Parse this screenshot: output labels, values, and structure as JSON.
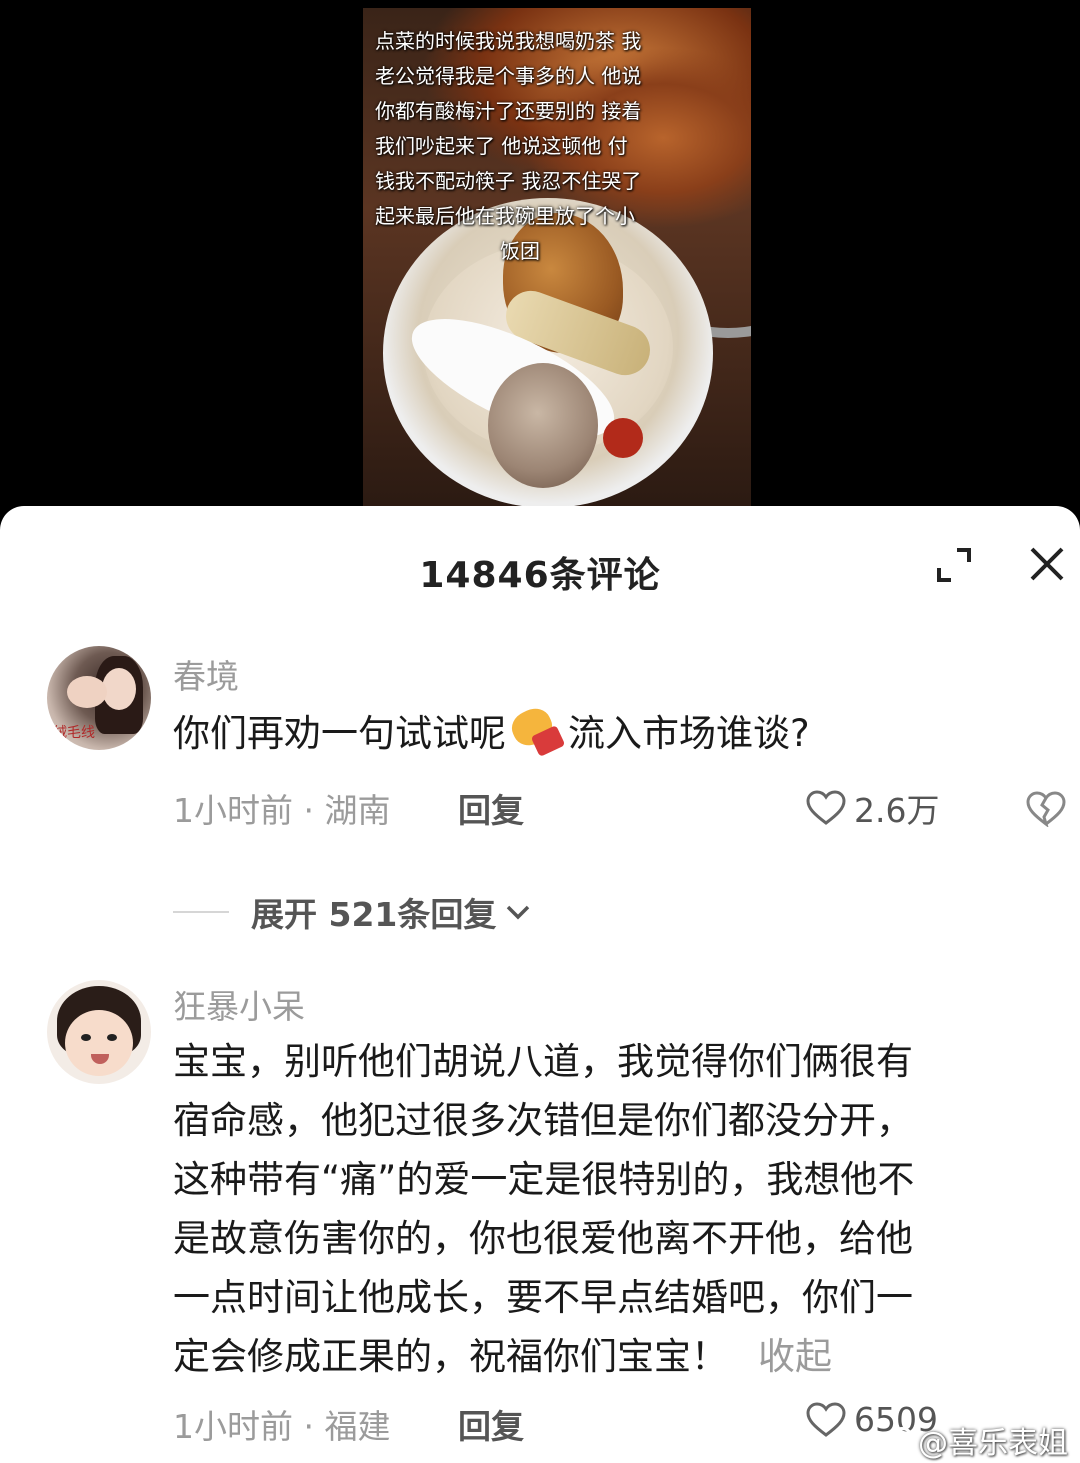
{
  "video": {
    "overlay_lines": [
      "点菜的时候我说我想喝奶茶 我",
      "老公觉得我是个事多的人 他说",
      "你都有酸梅汁了还要别的 接着",
      "我们吵起来了 他说这顿他 付",
      "钱我不配动筷子 我忍不住哭了",
      "起来最后他在我碗里放了个小",
      "饭团"
    ]
  },
  "sheet": {
    "title": "14846条评论"
  },
  "comments": [
    {
      "username": "春境",
      "avatar_caption": "绒毛线",
      "text_before": "你们再劝一句试试呢",
      "emoji": "fist-emoji",
      "text_after": "流入市场谁谈?",
      "meta": "1小时前 · 湖南",
      "reply_label": "回复",
      "likes": "2.6万",
      "expand_label": "展开 521条回复"
    },
    {
      "username": "狂暴小呆",
      "lines": [
        "宝宝，别听他们胡说八道，我觉得你们俩很有",
        "宿命感，他犯过很多次错但是你们都没分开，",
        "这种带有“痛”的爱一定是很特别的，我想他不",
        "是故意伤害你的，你也很爱他离不开他，给他",
        "一点时间让他成长，要不早点结婚吧，你们一",
        "定会修成正果的，祝福你们宝宝！"
      ],
      "collapse_label": "收起",
      "meta": "1小时前 · 福建",
      "reply_label": "回复",
      "likes": "6509"
    }
  ],
  "watermark": "@喜乐表姐"
}
